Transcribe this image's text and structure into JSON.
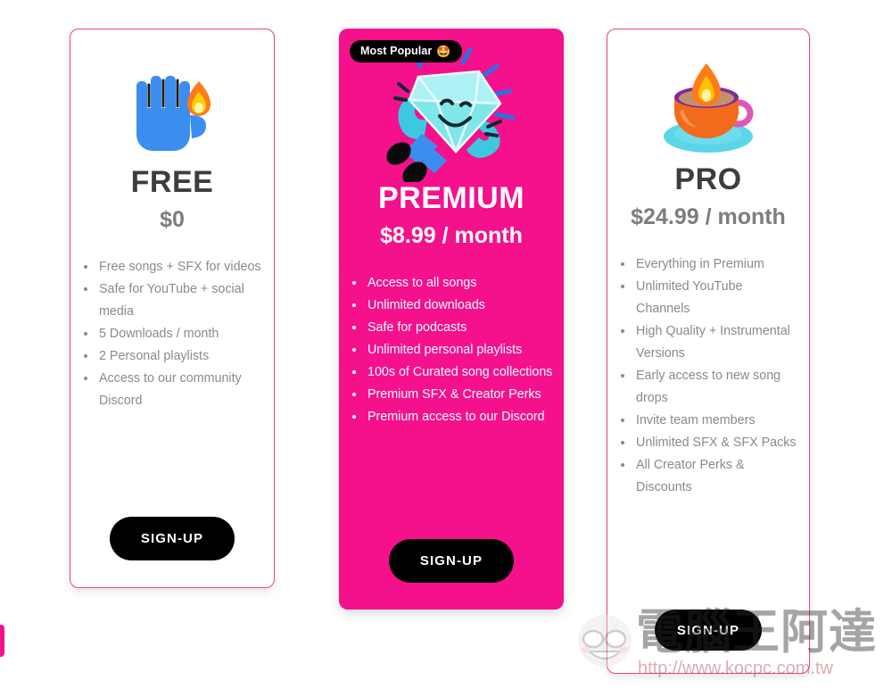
{
  "page": {
    "background": "#ffffff",
    "accent_pink": "#f5108c",
    "card_border": "#ef3f8e",
    "muted_text": "#8a8a8a"
  },
  "plans": [
    {
      "id": "free",
      "title": "FREE",
      "price": "$0",
      "icon": "hand-fire-illustration",
      "badge": null,
      "features": [
        "Free songs + SFX for videos",
        "Safe for YouTube + social media",
        "5 Downloads / month",
        "2 Personal playlists",
        "Access to our community Discord"
      ],
      "cta": "SIGN-UP"
    },
    {
      "id": "premium",
      "title": "PREMIUM",
      "price": "$8.99 / month",
      "icon": "running-diamond-illustration",
      "badge": {
        "label": "Most Popular",
        "emoji": "🤩"
      },
      "features": [
        "Access to all songs",
        "Unlimited downloads",
        "Safe for podcasts",
        "Unlimited personal playlists",
        "100s of Curated song collections",
        "Premium SFX & Creator Perks",
        "Premium access to our Discord"
      ],
      "cta": "SIGN-UP"
    },
    {
      "id": "pro",
      "title": "PRO",
      "price": "$24.99 / month",
      "icon": "coffee-cup-fire-illustration",
      "badge": null,
      "features": [
        "Everything in Premium",
        "Unlimited YouTube Channels",
        "High Quality + Instrumental Versions",
        "Early access to new song drops",
        "Invite team members",
        "Unlimited SFX & SFX Packs",
        "All Creator Perks & Discounts"
      ],
      "cta": "SIGN-UP"
    }
  ],
  "watermark": {
    "characters": "電腦王阿達",
    "url": "http://www.kocpc.com.tw"
  }
}
